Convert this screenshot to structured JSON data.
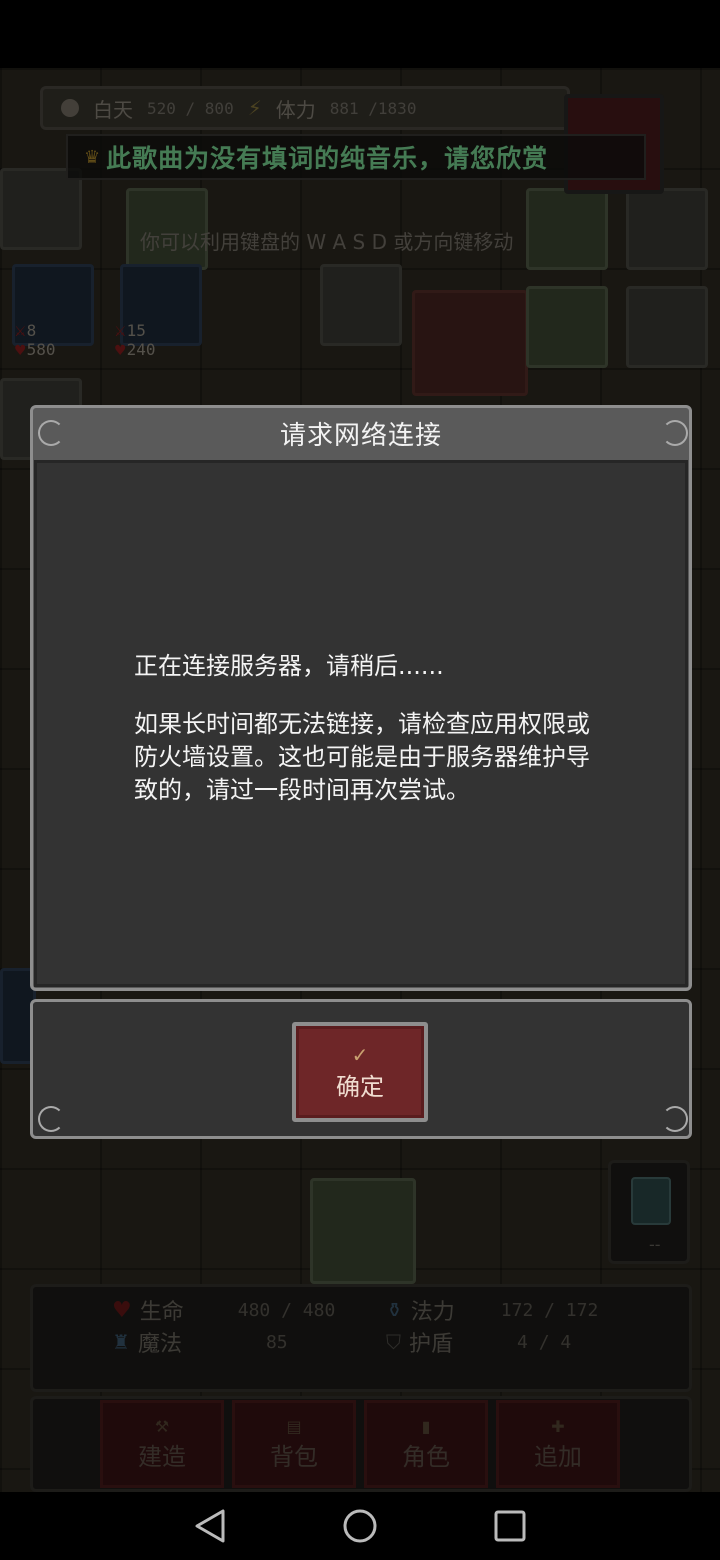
{
  "hud": {
    "day_label": "白天",
    "day_value": "520 / 800",
    "stamina_label": "体力",
    "stamina_value": "881 /1830"
  },
  "music_banner": "此歌曲为没有填词的纯音乐，请您欣赏",
  "hint": "你可以利用键盘的 W A S D 或方向键移动",
  "units": [
    {
      "atk": "8",
      "hp": "580"
    },
    {
      "atk": "15",
      "hp": "240"
    }
  ],
  "stats": {
    "life_label": "生命",
    "life_value": "480 / 480",
    "mana_label": "法力",
    "mana_value": "172 / 172",
    "magic_label": "魔法",
    "magic_value": "85",
    "shield_label": "护盾",
    "shield_value": "4 / 4"
  },
  "side_panel": {
    "value": "--"
  },
  "actions": {
    "build": "建造",
    "bag": "背包",
    "character": "角色",
    "add": "追加"
  },
  "dialog": {
    "title": "请求网络连接",
    "line1": "正在连接服务器，请稍后......",
    "paragraph": "如果长时间都无法链接，请检查应用权限或防火墙设置。这也可能是由于服务器维护导致的，请过一段时间再次尝试。",
    "confirm_label": "确定"
  },
  "colors": {
    "accent_green": "#7ee09a",
    "button_red": "#6e2628",
    "dialog_bg": "#333333"
  }
}
